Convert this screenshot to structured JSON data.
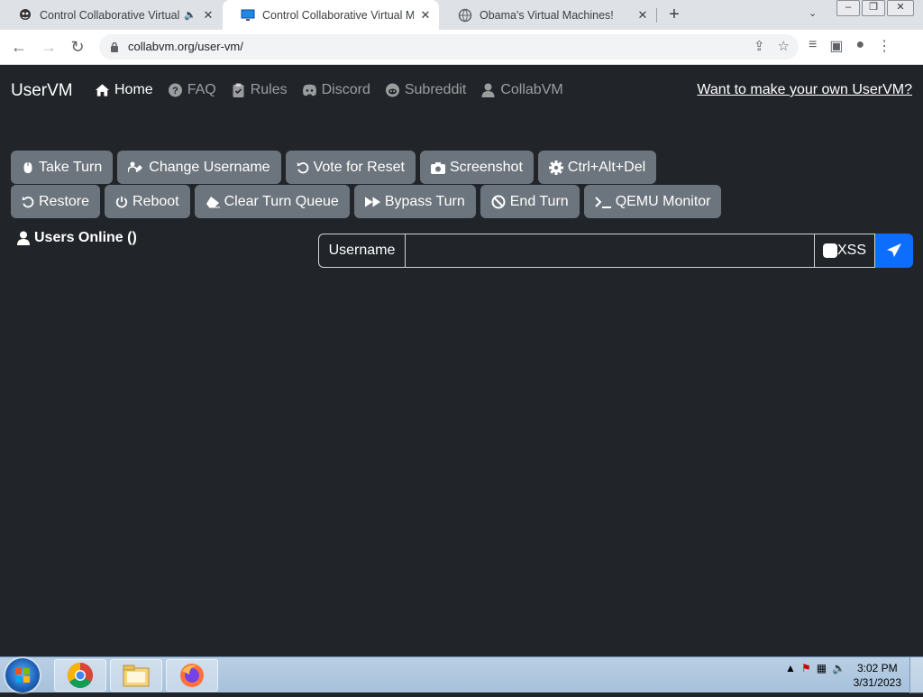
{
  "browser": {
    "tabs": [
      {
        "title": "Control Collaborative Virtual Machines!",
        "favicon": "collabvm-icon",
        "muted": true,
        "active": false
      },
      {
        "title": "Control Collaborative Virtual Machines!",
        "favicon": "monitor-icon",
        "active": true
      },
      {
        "title": "Obama's Virtual Machines!",
        "favicon": "globe-icon",
        "active": false
      }
    ],
    "url": "collabvm.org/user-vm/"
  },
  "navbar": {
    "brand": "UserVM",
    "links": [
      {
        "label": "Home",
        "icon": "home-icon",
        "active": true
      },
      {
        "label": "FAQ",
        "icon": "question-icon"
      },
      {
        "label": "Rules",
        "icon": "clipboard-icon"
      },
      {
        "label": "Discord",
        "icon": "discord-icon"
      },
      {
        "label": "Subreddit",
        "icon": "reddit-icon"
      },
      {
        "label": "CollabVM",
        "icon": "user-icon"
      }
    ],
    "cta": "Want to make your own UserVM?"
  },
  "controls": {
    "row1": [
      {
        "label": "Take Turn",
        "icon": "mouse-icon"
      },
      {
        "label": "Change Username",
        "icon": "users-icon"
      },
      {
        "label": "Vote for Reset",
        "icon": "undo-icon"
      },
      {
        "label": "Screenshot",
        "icon": "camera-icon"
      },
      {
        "label": "Ctrl+Alt+Del",
        "icon": "gear-icon"
      }
    ],
    "row2": [
      {
        "label": "Restore",
        "icon": "restore-icon"
      },
      {
        "label": "Reboot",
        "icon": "power-icon"
      },
      {
        "label": "Clear Turn Queue",
        "icon": "eraser-icon"
      },
      {
        "label": "Bypass Turn",
        "icon": "fast-forward-icon"
      },
      {
        "label": "End Turn",
        "icon": "ban-icon"
      },
      {
        "label": "QEMU Monitor",
        "icon": "terminal-icon"
      }
    ]
  },
  "users_online": "Users Online ()",
  "chat": {
    "username_label": "Username",
    "message_value": "",
    "xss_label": "XSS",
    "send_icon": "paper-plane-icon",
    "send_color": "#0d6efd"
  },
  "taskbar": {
    "apps": [
      "chrome-icon",
      "explorer-folder-icon",
      "firefox-icon"
    ],
    "time": "3:02 PM",
    "date": "3/31/2023"
  },
  "colors": {
    "page_bg": "#212529",
    "button_bg": "#6c757d",
    "accent": "#0d6efd"
  }
}
